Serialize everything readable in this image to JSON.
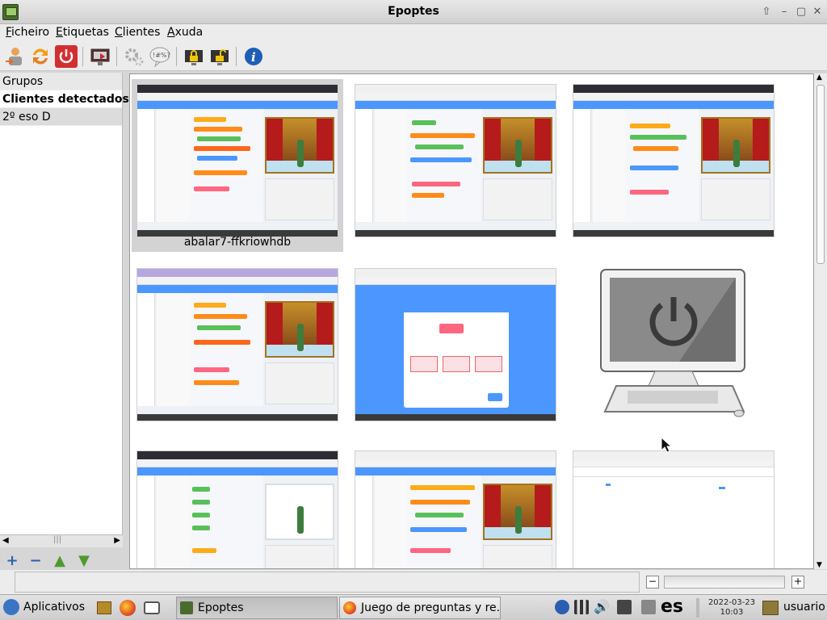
{
  "window": {
    "title": "Epoptes"
  },
  "menubar": {
    "items": [
      {
        "first": "F",
        "rest": "icheiro"
      },
      {
        "first": "E",
        "rest": "tiquetas"
      },
      {
        "first": "C",
        "rest": "lientes"
      },
      {
        "first": "A",
        "rest": "xuda"
      }
    ]
  },
  "toolbar": {
    "icons": [
      "user-login-icon",
      "refresh-icon",
      "power-icon",
      "monitor-broadcast-icon",
      "settings-gears-icon",
      "message-bubble-icon",
      "lock-screen-icon",
      "unlock-screen-icon",
      "info-icon"
    ],
    "colors": {
      "power": "#d32f2f",
      "refresh": "#f39c12",
      "info": "#1e5eb8"
    }
  },
  "sidebar": {
    "items": [
      "Grupos",
      "Clientes detectados",
      "2º eso D"
    ]
  },
  "clients": {
    "selected_caption": "abalar7-ffkriowhdb",
    "cursor_hint": ""
  },
  "taskbar": {
    "apps_label": "Aplicativos",
    "tasks": [
      "Epoptes",
      "Juego de preguntas y re..."
    ],
    "lang": "es",
    "date": "2022-03-23",
    "time": "10:03",
    "user": "usuario"
  }
}
